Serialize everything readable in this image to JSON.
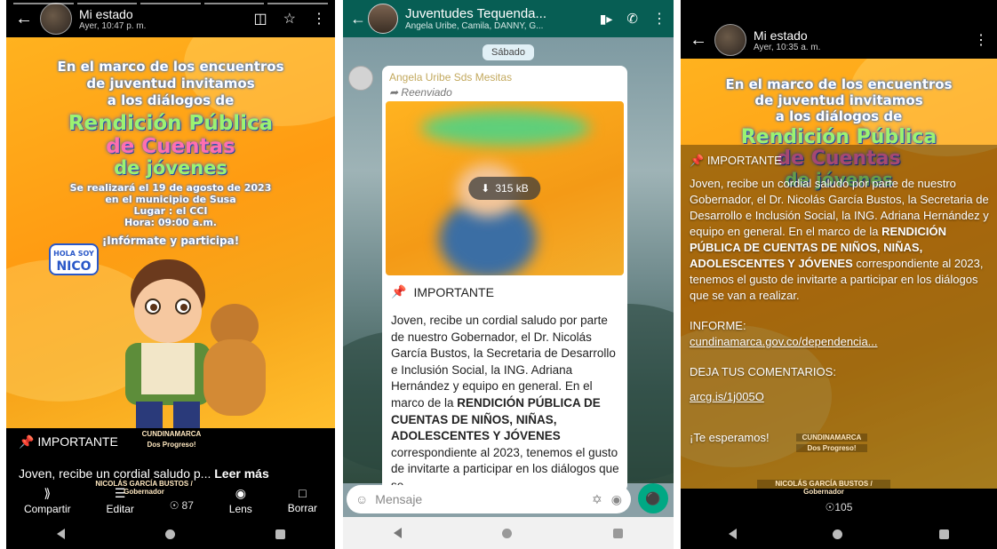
{
  "left": {
    "title": "Mi estado",
    "subtitle": "Ayer, 10:47 p. m.",
    "icons": [
      "back-icon",
      "cast-icon",
      "star-icon",
      "more-icon"
    ],
    "poster": {
      "line1": "En el marco de los encuentros",
      "line2": "de juventud invitamos",
      "line3": "a los diálogos de",
      "big1": "Rendición Pública",
      "big2": "de Cuentas",
      "big3": "de jóvenes",
      "d1": "Se realizará el 19 de agosto de 2023",
      "d2": "en el municipio de Susa",
      "d3": "Lugar : el CCI",
      "d4": "Hora: 09:00 a.m.",
      "cta": "¡Infórmate y participa!",
      "bubble1": "HOLA SOY",
      "bubble2": "NICO",
      "brand": "CUNDINAMARCA",
      "slogan": "Dos Progreso!",
      "signature": "NICOLÁS GARCÍA BUSTOS / Gobernador"
    },
    "caption_title": "IMPORTANTE",
    "caption_text": "Joven, recibe un cordial saludo p...",
    "read_more": "Leer más",
    "actions": [
      {
        "icon": "share-icon",
        "label": "Compartir"
      },
      {
        "icon": "edit-icon",
        "label": "Editar"
      },
      {
        "icon": "lens-icon",
        "label": "Lens"
      },
      {
        "icon": "delete-icon",
        "label": "Borrar"
      }
    ],
    "views": "87"
  },
  "middle": {
    "group_name": "Juventudes Tequenda...",
    "members": "Angela Uribe, Camila, DANNY, G...",
    "day": "Sábado",
    "sender": "Angela Uribe Sds Mesitas",
    "forwarded": "Reenviado",
    "download": "315 kB",
    "important": "IMPORTANTE",
    "body1": "Joven, recibe un cordial saludo por parte de nuestro Gobernador, el Dr. Nicolás García Bustos, la Secretaria de Desarrollo e Inclusión Social, la ING. Adriana Hernández  y equipo en general. En el marco de la ",
    "body_bold": "RENDICIÓN PÚBLICA DE CUENTAS DE NIÑOS, NIÑAS, ADOLESCENTES Y JÓVENES",
    "body2": " correspondiente al 2023, tenemos el gusto de invitarte a participar en los diálogos que se",
    "placeholder": "Mensaje"
  },
  "right": {
    "title": "Mi estado",
    "subtitle": "Ayer, 10:35 a. m.",
    "important": "IMPORTANTE",
    "para1": "Joven, recibe un cordial saludo por parte de nuestro Gobernador, el Dr. Nicolás García Bustos, la Secretaria de Desarrollo e Inclusión Social, la ING. Adriana Hernández  y equipo en general. En el marco de la ",
    "para_bold": "RENDICIÓN PÚBLICA DE CUENTAS DE NIÑOS, NIÑAS, ADOLESCENTES Y JÓVENES",
    "para2": " correspondiente al 2023, tenemos el gusto de invitarte a participar en los diálogos que se van a realizar.",
    "informe_label": "INFORME:",
    "informe_link": "cundinamarca.gov.co/dependencia...",
    "comentarios_label": "DEJA TUS COMENTARIOS:",
    "comentarios_link": "arcg.is/1j005O",
    "closing": "¡Te esperamos!",
    "views": "105"
  }
}
